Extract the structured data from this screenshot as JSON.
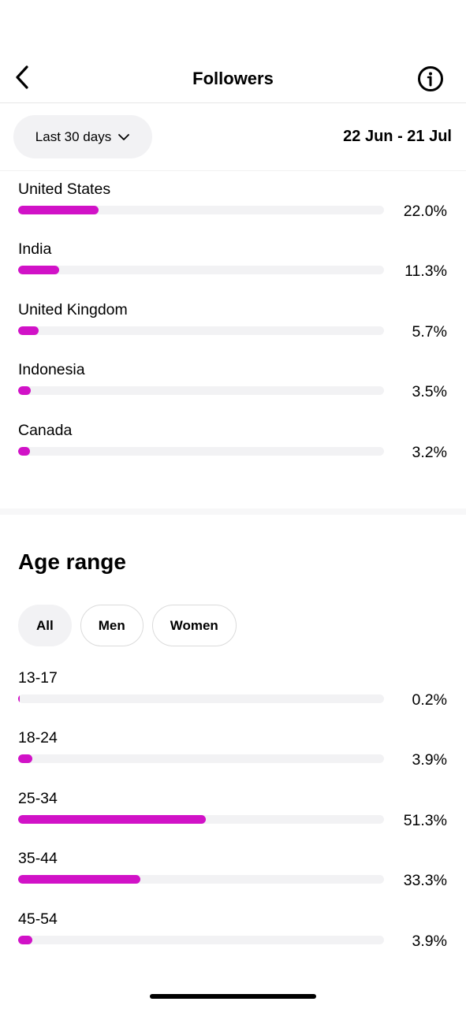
{
  "header": {
    "title": "Followers",
    "back_icon": "chevron-left-icon",
    "info_icon": "info-circle-icon"
  },
  "filter": {
    "period_label": "Last 30 days",
    "period_icon": "chevron-down-icon",
    "date_range": "22 Jun - 21 Jul"
  },
  "countries": [
    {
      "label": "United States",
      "value": "22.0%",
      "fraction": 0.22
    },
    {
      "label": "India",
      "value": "11.3%",
      "fraction": 0.113
    },
    {
      "label": "United Kingdom",
      "value": "5.7%",
      "fraction": 0.057
    },
    {
      "label": "Indonesia",
      "value": "3.5%",
      "fraction": 0.035
    },
    {
      "label": "Canada",
      "value": "3.2%",
      "fraction": 0.032
    }
  ],
  "age_section": {
    "title": "Age range",
    "chips": [
      {
        "label": "All",
        "selected": true
      },
      {
        "label": "Men",
        "selected": false
      },
      {
        "label": "Women",
        "selected": false
      }
    ]
  },
  "ages": [
    {
      "label": "13-17",
      "value": "0.2%",
      "fraction": 0.002
    },
    {
      "label": "18-24",
      "value": "3.9%",
      "fraction": 0.039
    },
    {
      "label": "25-34",
      "value": "51.3%",
      "fraction": 0.513
    },
    {
      "label": "35-44",
      "value": "33.3%",
      "fraction": 0.333
    },
    {
      "label": "45-54",
      "value": "3.9%",
      "fraction": 0.039
    }
  ],
  "colors": {
    "bar_fill": "#d112c7",
    "bar_track": "#f2f2f4"
  }
}
